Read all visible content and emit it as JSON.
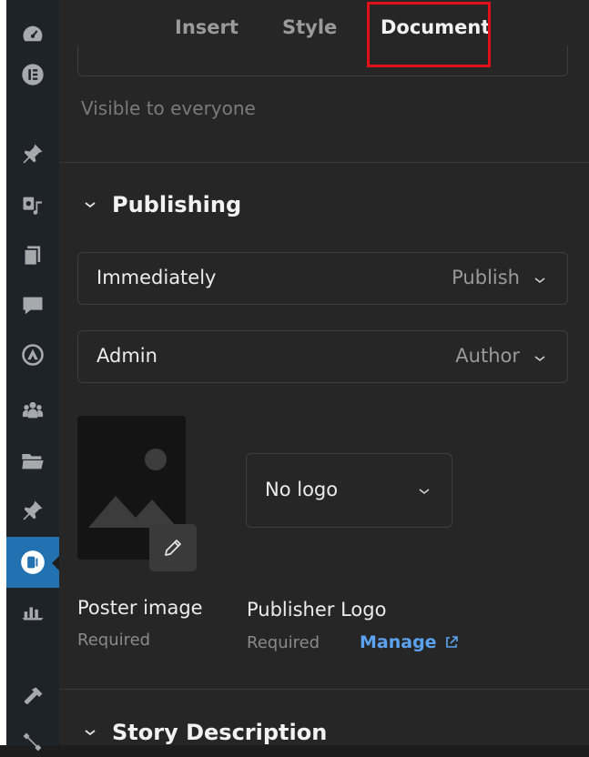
{
  "tabs": [
    {
      "label": "Insert",
      "active": false
    },
    {
      "label": "Style",
      "active": false
    },
    {
      "label": "Document",
      "active": true
    }
  ],
  "visibility": {
    "note": "Visible to everyone"
  },
  "publishing": {
    "title": "Publishing",
    "rows": [
      {
        "label": "Immediately",
        "value": "Publish"
      },
      {
        "label": "Admin",
        "value": "Author"
      }
    ]
  },
  "poster": {
    "caption": "Poster image",
    "required": "Required"
  },
  "publisher_logo": {
    "select_value": "No logo",
    "caption": "Publisher Logo",
    "required": "Required",
    "manage_label": "Manage"
  },
  "story_description": {
    "title": "Story Description"
  },
  "sidebar": {
    "icons": [
      "dashboard-icon",
      "elementor-icon",
      "pin-icon",
      "media-icon",
      "pages-icon",
      "comments-icon",
      "astra-icon",
      "users-icon",
      "folder-icon",
      "pin-icon",
      "web-stories-icon",
      "stats-icon",
      "tools-icon",
      "settings-icon"
    ]
  },
  "colors": {
    "highlight": "#e0111b",
    "accent": "#2271b1",
    "link": "#5ba2f0"
  }
}
